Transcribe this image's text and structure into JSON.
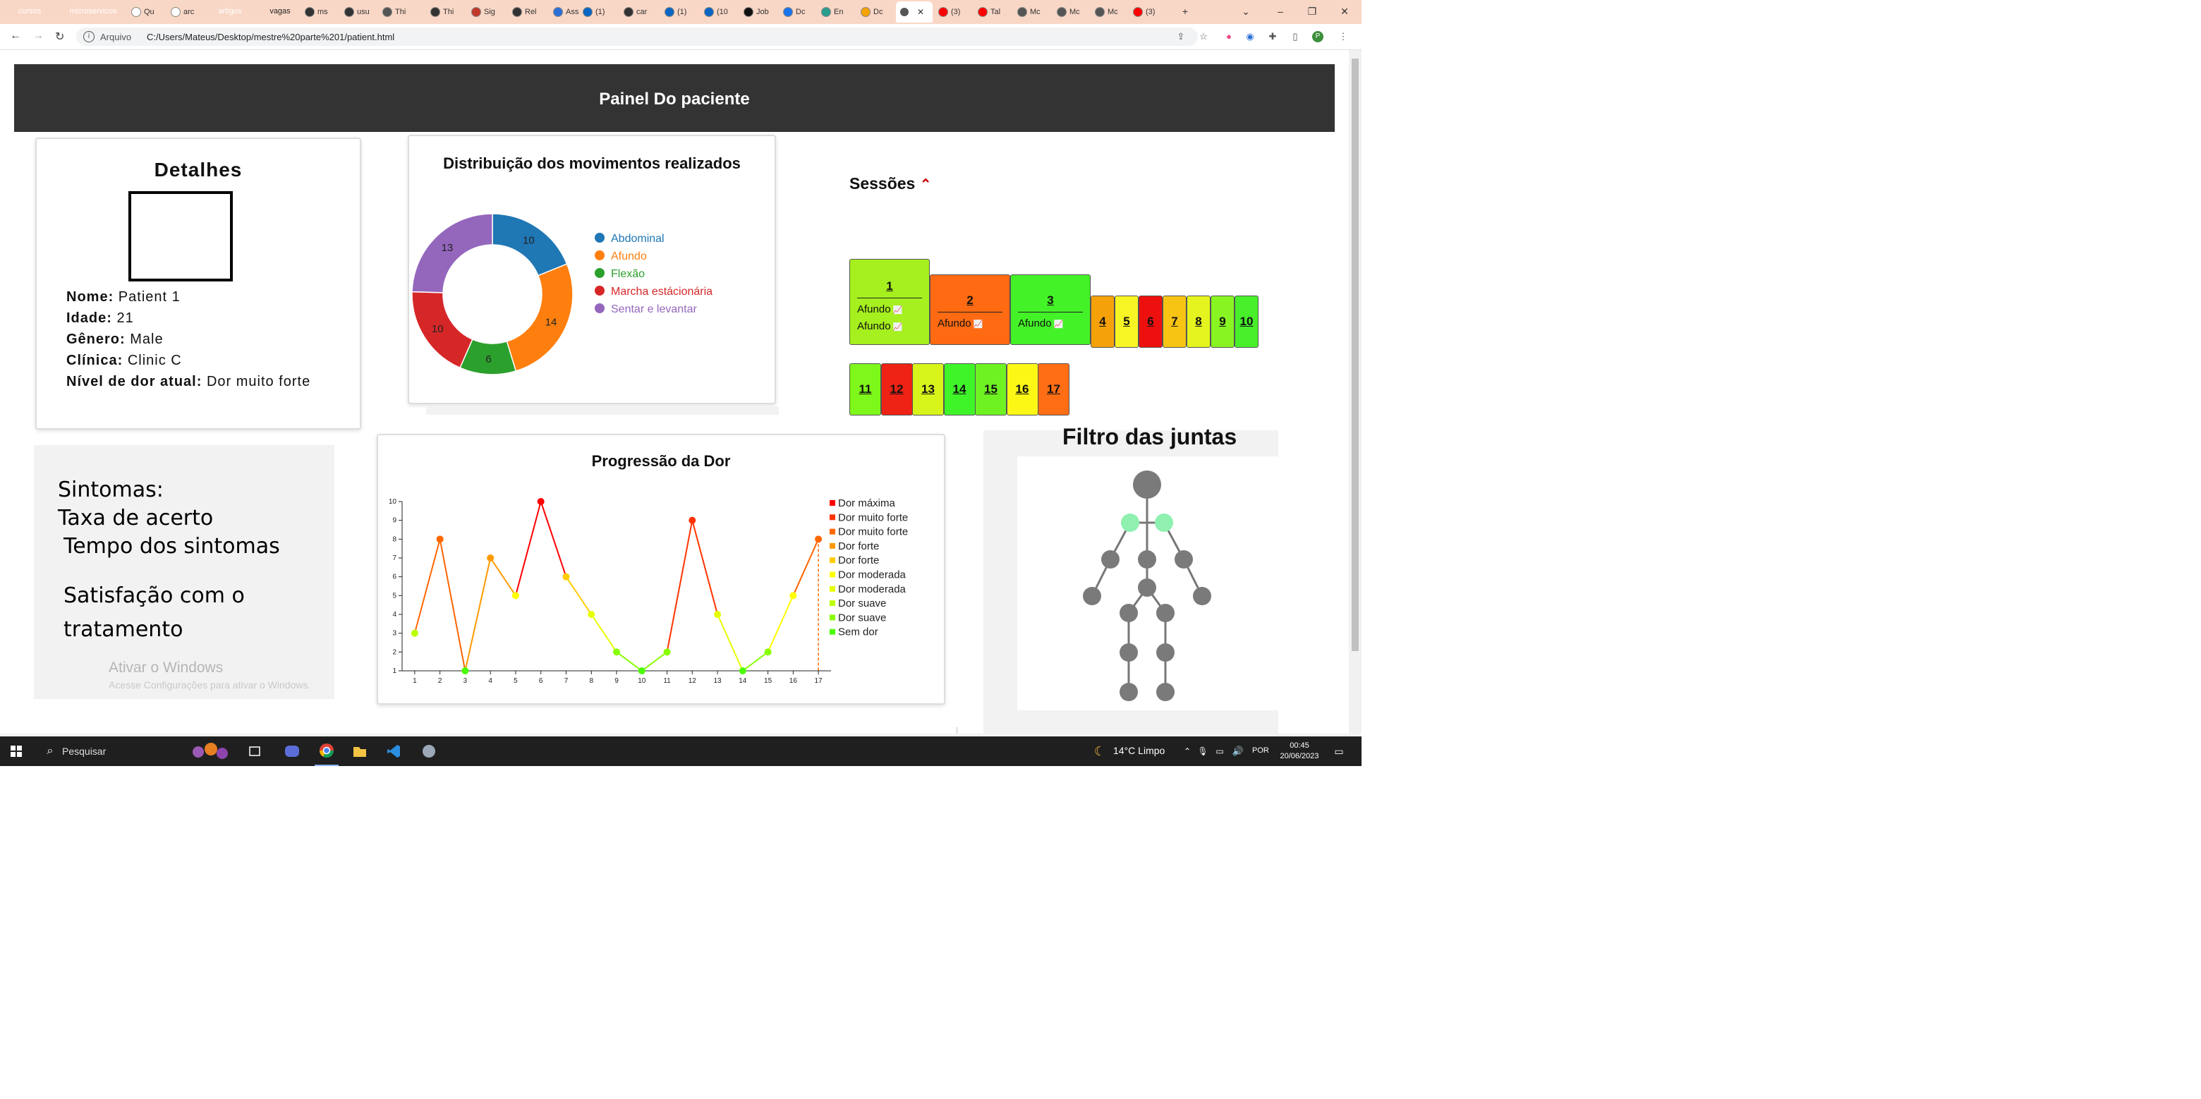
{
  "browser": {
    "pills": [
      {
        "label": "cursos",
        "color": "#5f6368"
      },
      {
        "label": "microservicos",
        "color": "#1a73e8"
      },
      {
        "label": "artigos",
        "color": "#d93025"
      },
      {
        "label": "vagas",
        "color": "#f9ab00"
      }
    ],
    "tabs": [
      "Qu",
      "arc",
      "ms",
      "usu",
      "Thi",
      "Thi",
      "Sig",
      "Rel",
      "Ass",
      "(1)",
      "car",
      "(1)",
      "(10",
      "Job",
      "Dc",
      "En",
      "Dc",
      "(3)",
      "Tal",
      "Mc",
      "Mc",
      "Mc",
      "(3)"
    ],
    "new_tab": "+",
    "address_label": "Arquivo",
    "url": "C:/Users/Mateus/Desktop/mestre%20parte%201/patient.html",
    "profile_initial": "P"
  },
  "header": {
    "title": "Painel Do paciente"
  },
  "details": {
    "title": "Detalhes",
    "rows": [
      {
        "label": "Nome:",
        "value": "Patient 1"
      },
      {
        "label": "Idade:",
        "value": "21"
      },
      {
        "label": "Gênero:",
        "value": "Male"
      },
      {
        "label": "Clínica:",
        "value": "Clinic C"
      },
      {
        "label": "Nível de dor atual:",
        "value": "Dor muito forte"
      }
    ]
  },
  "movements": {
    "title": "Distribuição dos movimentos realizados",
    "legend": [
      {
        "label": "Abdominal",
        "color": "#1f77b4"
      },
      {
        "label": "Afundo",
        "color": "#ff7f0e"
      },
      {
        "label": "Flexão",
        "color": "#2ca02c"
      },
      {
        "label": "Marcha estácionária",
        "color": "#d62728"
      },
      {
        "label": "Sentar e levantar",
        "color": "#9467bd"
      }
    ]
  },
  "sessions": {
    "title": "Sessões",
    "items": [
      {
        "n": "1",
        "color": "#a6f01f",
        "movements": [
          "Afundo",
          "Afundo"
        ]
      },
      {
        "n": "2",
        "color": "#ff6a12",
        "movements": [
          "Afundo"
        ]
      },
      {
        "n": "3",
        "color": "#43f227",
        "movements": [
          "Afundo"
        ]
      },
      {
        "n": "4",
        "color": "#f5a20a"
      },
      {
        "n": "5",
        "color": "#f8f524"
      },
      {
        "n": "6",
        "color": "#ee0f0f"
      },
      {
        "n": "7",
        "color": "#f7c414"
      },
      {
        "n": "8",
        "color": "#e5f41e"
      },
      {
        "n": "9",
        "color": "#88f421"
      },
      {
        "n": "10",
        "color": "#47f02a"
      },
      {
        "n": "11",
        "color": "#7ef71a"
      },
      {
        "n": "12",
        "color": "#ee2315"
      },
      {
        "n": "13",
        "color": "#d8f51b"
      },
      {
        "n": "14",
        "color": "#3ff52a"
      },
      {
        "n": "15",
        "color": "#6ff222"
      },
      {
        "n": "16",
        "color": "#fcf715"
      },
      {
        "n": "17",
        "color": "#ff6d14"
      }
    ]
  },
  "symptoms": {
    "lines": [
      "Sintomas:",
      "Taxa de acerto",
      "Tempo dos sintomas",
      "Satisfação com o",
      "tratamento"
    ],
    "watermark_title": "Ativar o Windows",
    "watermark_sub": "Acesse Configurações para ativar o Windows."
  },
  "pain": {
    "title": "Progressão da Dor"
  },
  "joints": {
    "title": "Filtro das juntas"
  },
  "taskbar": {
    "search": "Pesquisar",
    "weather": "14°C  Limpo",
    "lang": "POR",
    "time": "00:45",
    "date": "20/06/2023"
  },
  "chart_data": [
    {
      "type": "pie",
      "title": "Distribuição dos movimentos realizados",
      "categories": [
        "Abdominal",
        "Afundo",
        "Flexão",
        "Marcha estácionária",
        "Sentar e levantar"
      ],
      "values": [
        10,
        14,
        6,
        10,
        13
      ],
      "colors": [
        "#1f77b4",
        "#ff7f0e",
        "#2ca02c",
        "#d62728",
        "#9467bd"
      ],
      "donut": true,
      "legend": "right"
    },
    {
      "type": "line",
      "title": "Progressão da Dor",
      "x": [
        1,
        2,
        3,
        4,
        5,
        6,
        7,
        8,
        9,
        10,
        11,
        12,
        13,
        14,
        15,
        16,
        17
      ],
      "y": [
        3,
        8,
        1,
        7,
        5,
        10,
        6,
        4,
        2,
        1,
        2,
        9,
        4,
        1,
        2,
        5,
        8
      ],
      "xlim": [
        0.5,
        17.5
      ],
      "ylim": [
        1,
        10
      ],
      "yticks": [
        1,
        2,
        3,
        4,
        5,
        6,
        7,
        8,
        9,
        10
      ],
      "level_colors": {
        "1": "#4cff00",
        "2": "#88ff00",
        "3": "#bbff00",
        "4": "#e6ff00",
        "5": "#ffff00",
        "6": "#ffcc00",
        "7": "#ff9900",
        "8": "#ff6600",
        "9": "#ff3300",
        "10": "#ff0000"
      },
      "legend": "right",
      "legend_items": [
        {
          "label": "Dor máxima",
          "color": "#ff0000"
        },
        {
          "label": "Dor muito forte",
          "color": "#ff3300"
        },
        {
          "label": "Dor muito forte",
          "color": "#ff6600"
        },
        {
          "label": "Dor forte",
          "color": "#ff9900"
        },
        {
          "label": "Dor forte",
          "color": "#ffcc00"
        },
        {
          "label": "Dor moderada",
          "color": "#ffff00"
        },
        {
          "label": "Dor moderada",
          "color": "#e6ff00"
        },
        {
          "label": "Dor suave",
          "color": "#bbff00"
        },
        {
          "label": "Dor suave",
          "color": "#88ff00"
        },
        {
          "label": "Sem dor",
          "color": "#4cff00"
        }
      ]
    }
  ]
}
